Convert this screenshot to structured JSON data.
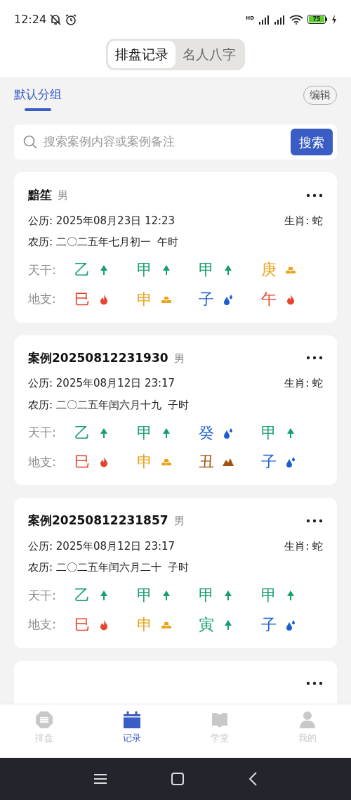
{
  "status_bar": {
    "time": "12:24",
    "battery": "75",
    "hd": "HD"
  },
  "top_tabs": [
    {
      "label": "排盘记录",
      "selected": true
    },
    {
      "label": "名人八字",
      "selected": false
    }
  ],
  "group_tabs": [
    {
      "label": "默认分组",
      "selected": true
    }
  ],
  "edit_button": "编辑",
  "search": {
    "placeholder": "搜索案例内容或案例备注",
    "button": "搜索"
  },
  "cards": [
    {
      "name": "黯笙",
      "gender": "男",
      "solar": "公历: 2025年08月23日 12:23",
      "zodiac": "生肖: 蛇",
      "lunar": "农历: 二〇二五年七月初一  午时",
      "stems_label": "天干:",
      "branches_label": "地支:",
      "stems": [
        {
          "char": "乙",
          "kind": "wood",
          "color": "#17a06a"
        },
        {
          "char": "甲",
          "kind": "wood",
          "color": "#17a06a"
        },
        {
          "char": "甲",
          "kind": "wood",
          "color": "#17a06a"
        },
        {
          "char": "庚",
          "kind": "metal",
          "color": "#e8a317"
        }
      ],
      "branches": [
        {
          "char": "巳",
          "kind": "fire",
          "color": "#e8432e"
        },
        {
          "char": "申",
          "kind": "metal",
          "color": "#e8a317"
        },
        {
          "char": "子",
          "kind": "water",
          "color": "#1a5fd0"
        },
        {
          "char": "午",
          "kind": "fire",
          "color": "#e8432e"
        }
      ]
    },
    {
      "name": "案例20250812231930",
      "gender": "男",
      "solar": "公历: 2025年08月12日 23:17",
      "zodiac": "生肖: 蛇",
      "lunar": "农历: 二〇二五年闰六月十九  子时",
      "stems_label": "天干:",
      "branches_label": "地支:",
      "stems": [
        {
          "char": "乙",
          "kind": "wood",
          "color": "#17a06a"
        },
        {
          "char": "甲",
          "kind": "wood",
          "color": "#17a06a"
        },
        {
          "char": "癸",
          "kind": "water",
          "color": "#1a5fd0"
        },
        {
          "char": "甲",
          "kind": "wood",
          "color": "#17a06a"
        }
      ],
      "branches": [
        {
          "char": "巳",
          "kind": "fire",
          "color": "#e8432e"
        },
        {
          "char": "申",
          "kind": "metal",
          "color": "#e8a317"
        },
        {
          "char": "丑",
          "kind": "earth",
          "color": "#a0520e"
        },
        {
          "char": "子",
          "kind": "water",
          "color": "#1a5fd0"
        }
      ]
    },
    {
      "name": "案例20250812231857",
      "gender": "男",
      "solar": "公历: 2025年08月12日 23:17",
      "zodiac": "生肖: 蛇",
      "lunar": "农历: 二〇二五年闰六月二十  子时",
      "stems_label": "天干:",
      "branches_label": "地支:",
      "stems": [
        {
          "char": "乙",
          "kind": "wood",
          "color": "#17a06a"
        },
        {
          "char": "甲",
          "kind": "wood",
          "color": "#17a06a"
        },
        {
          "char": "甲",
          "kind": "wood",
          "color": "#17a06a"
        },
        {
          "char": "甲",
          "kind": "wood",
          "color": "#17a06a"
        }
      ],
      "branches": [
        {
          "char": "巳",
          "kind": "fire",
          "color": "#e8432e"
        },
        {
          "char": "申",
          "kind": "metal",
          "color": "#e8a317"
        },
        {
          "char": "寅",
          "kind": "wood",
          "color": "#17a06a"
        },
        {
          "char": "子",
          "kind": "water",
          "color": "#1a5fd0"
        }
      ]
    },
    {
      "kind": "partial"
    }
  ],
  "bottom_nav": [
    {
      "label": "排盘",
      "kind": "chart",
      "selected": false
    },
    {
      "label": "记录",
      "kind": "calendar",
      "selected": true
    },
    {
      "label": "学堂",
      "kind": "book",
      "selected": false
    },
    {
      "label": "我的",
      "kind": "person",
      "selected": false
    }
  ]
}
